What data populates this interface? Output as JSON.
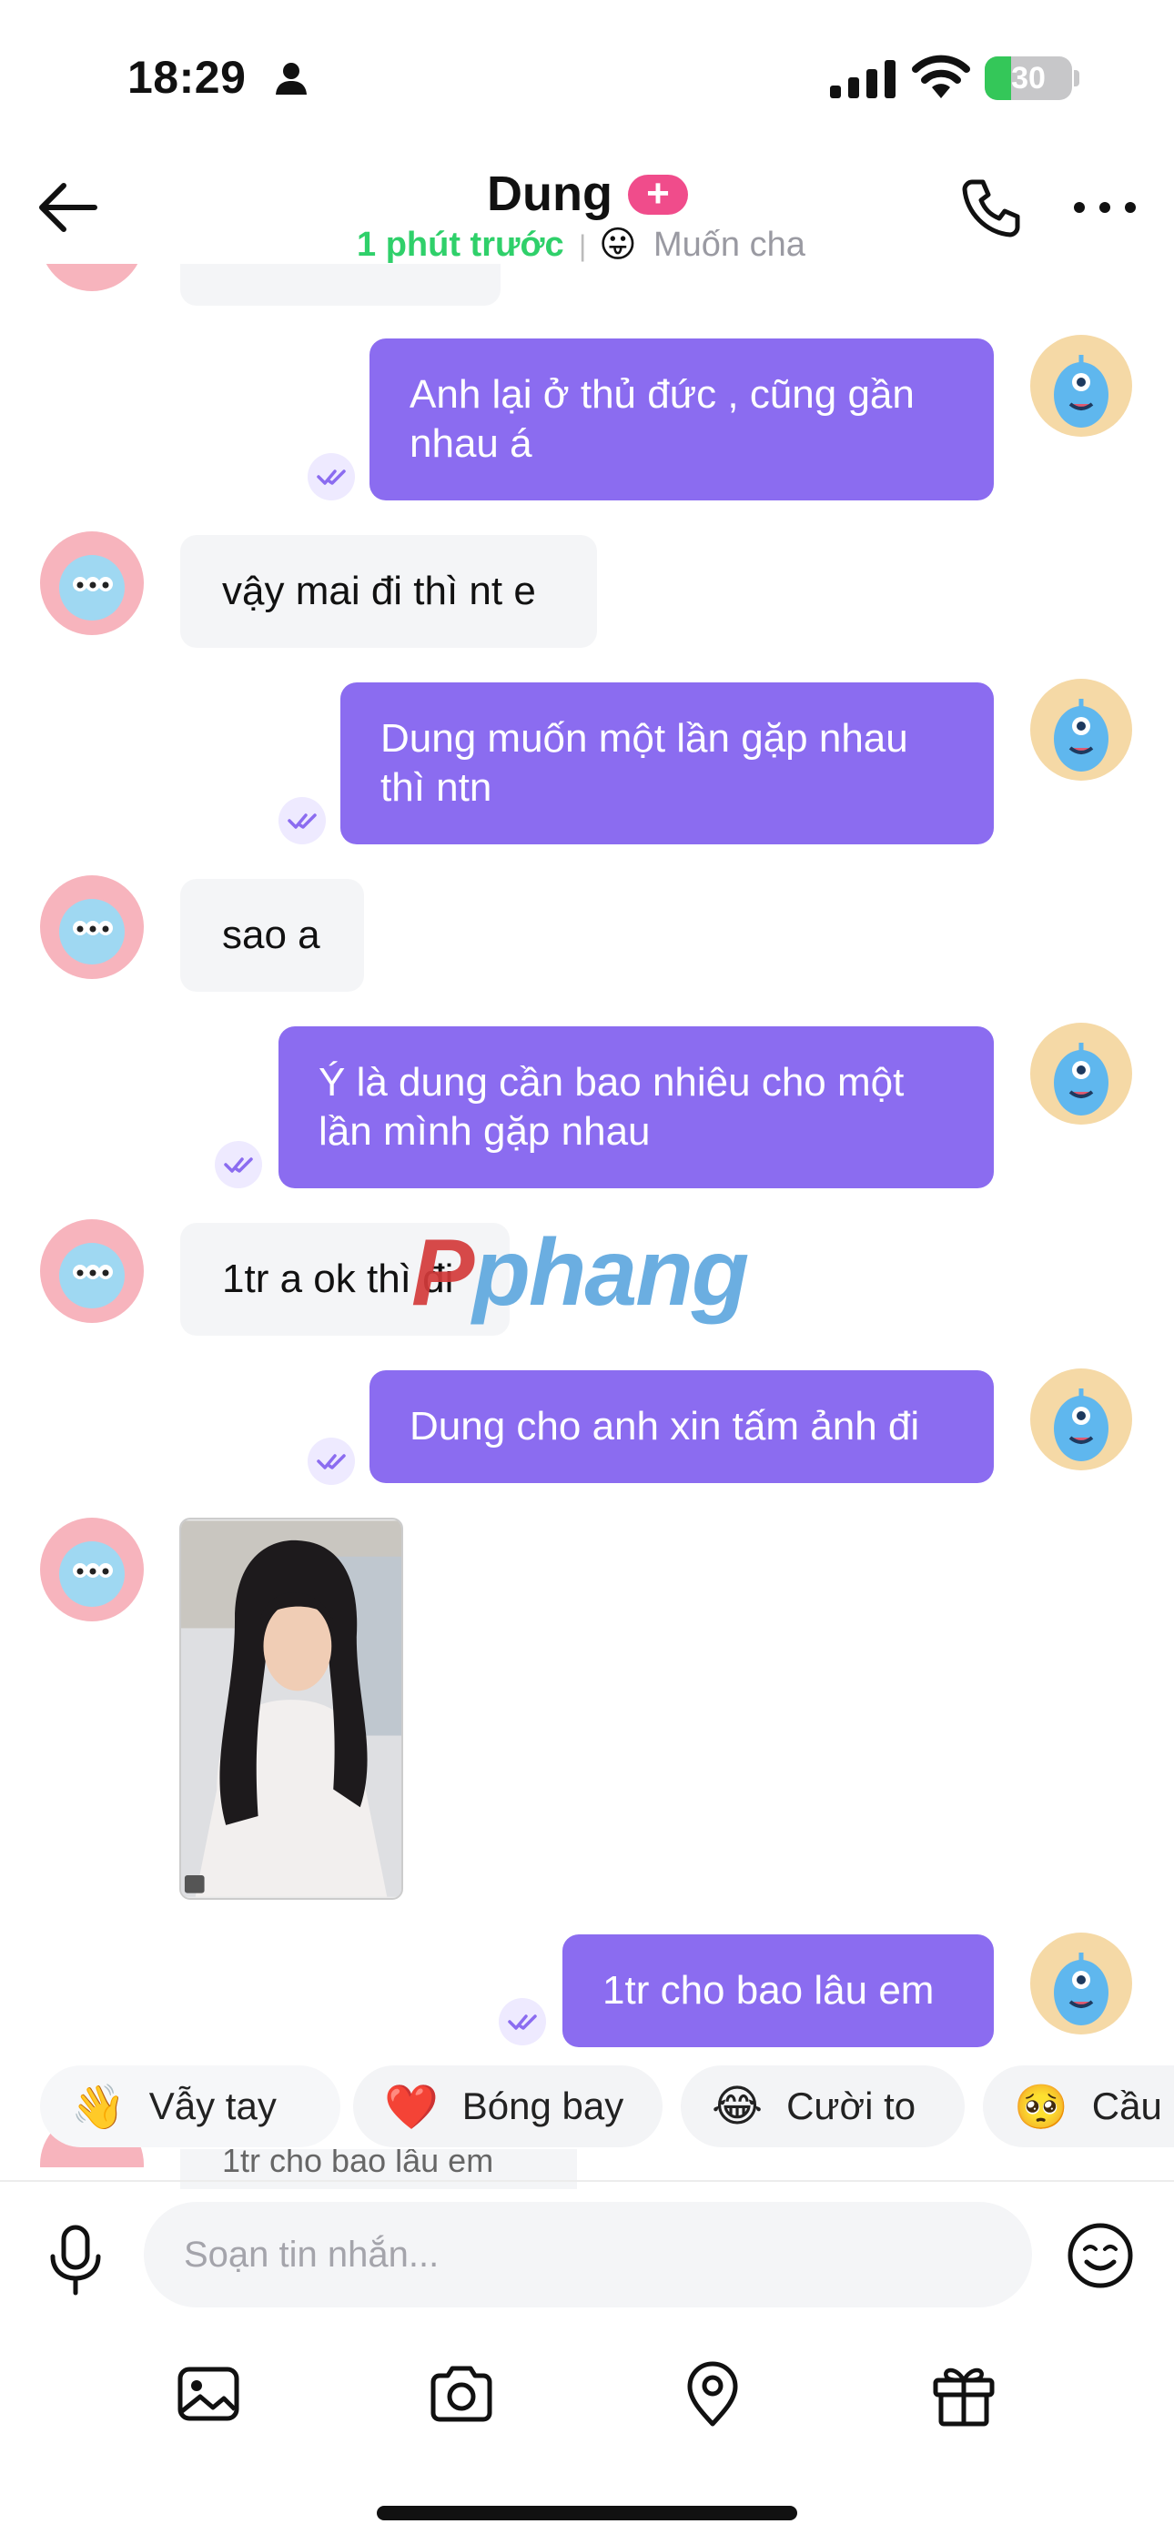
{
  "status_bar": {
    "time": "18:29",
    "battery": "30",
    "battery_level_percent": 30
  },
  "header": {
    "contact_name": "Dung",
    "plus_badge": "+",
    "last_seen": "1 phút trước",
    "separator": "|",
    "mood_emoji": "😛",
    "mood_text": "Muốn cha",
    "icons": [
      "back-arrow-icon",
      "phone-icon",
      "more-dots-icon"
    ]
  },
  "messages": [
    {
      "from": "me",
      "text": "Anh lại ở thủ đức , cũng gần nhau á"
    },
    {
      "from": "her",
      "text": "vậy mai đi thì nt e"
    },
    {
      "from": "me",
      "text": "Dung muốn một lần gặp nhau thì ntn"
    },
    {
      "from": "her",
      "text": "sao a"
    },
    {
      "from": "me",
      "text": "Ý là dung cần bao nhiêu cho một lần mình gặp nhau"
    },
    {
      "from": "her",
      "text": "1tr a ok thì đi"
    },
    {
      "from": "me",
      "text": "Dung cho anh xin tấm ảnh đi"
    },
    {
      "from": "her",
      "type": "photo"
    },
    {
      "from": "me",
      "text": "1tr cho bao lâu em"
    },
    {
      "from": "her",
      "text": "1tr cho bao lâu em"
    }
  ],
  "watermark": {
    "first": "P",
    "rest": "phang"
  },
  "quick_reactions": [
    {
      "emoji": "👋",
      "label": "Vẫy tay"
    },
    {
      "emoji": "❤️",
      "label": "Bóng bay"
    },
    {
      "emoji": "😂",
      "label": "Cười to"
    },
    {
      "emoji": "🥺",
      "label": "Cầu"
    }
  ],
  "composer": {
    "placeholder": "Soạn tin nhắn...",
    "icons": [
      "microphone-icon",
      "emoji-smile-icon",
      "image-icon",
      "camera-icon",
      "location-pin-icon",
      "gift-icon"
    ]
  },
  "colors": {
    "outgoing_bubble": "#8b6cf0",
    "incoming_bubble": "#f4f5f7",
    "online_green": "#2fd06a",
    "plus_badge": "#f04c8b"
  }
}
